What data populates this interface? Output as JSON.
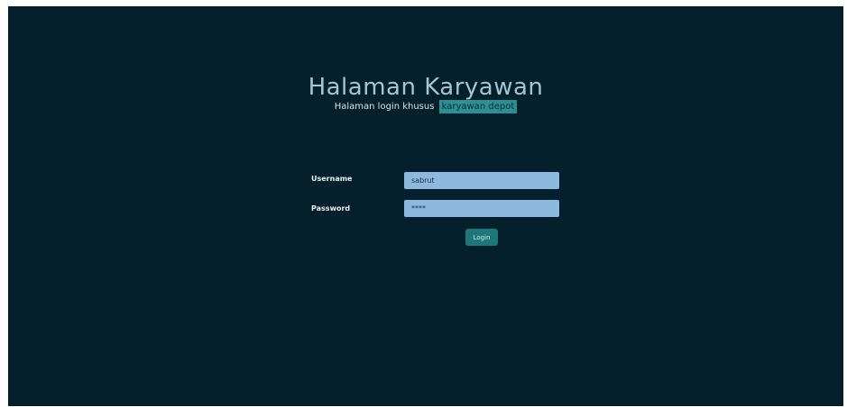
{
  "header": {
    "title": "Halaman Karyawan",
    "subtitle_lead": "Halaman login khusus",
    "subtitle_highlight": "karyawan depot"
  },
  "form": {
    "username": {
      "label": "Username",
      "value": "sabrut"
    },
    "password": {
      "label": "Password",
      "value": "****"
    },
    "submit_label": "Login"
  },
  "colors": {
    "background": "#03202c",
    "title": "#a9c3d6",
    "highlight": "#2c8f93",
    "input_fill": "#8fb8de",
    "button": "#1e7779"
  }
}
